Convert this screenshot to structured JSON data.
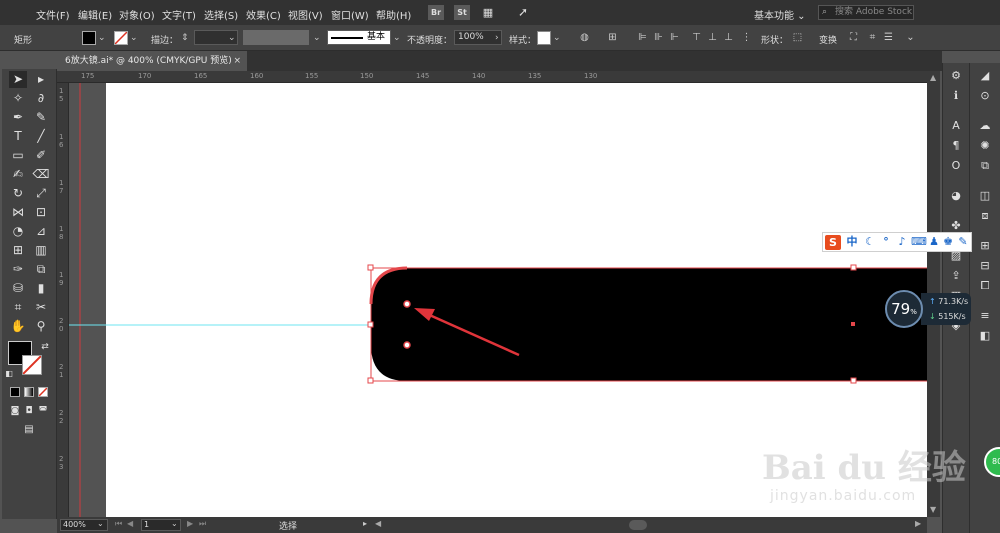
{
  "menubar": {
    "items": [
      "文件(F)",
      "编辑(E)",
      "对象(O)",
      "文字(T)",
      "选择(S)",
      "效果(C)",
      "视图(V)",
      "窗口(W)",
      "帮助(H)"
    ],
    "bridge_label": "Br",
    "stock_label": "St",
    "workspace": "基本功能",
    "search_placeholder": "搜索 Adobe Stock"
  },
  "controlbar": {
    "object_type": "矩形",
    "stroke_label": "描边：",
    "stroke_profile": "基本",
    "opacity_label": "不透明度：",
    "opacity_value": "100%",
    "style_label": "样式：",
    "shape_label": "形状：",
    "transform_label": "变换"
  },
  "document_tab": {
    "title": "6放大镜.ai* @ 400% (CMYK/GPU 预览)",
    "close": "×"
  },
  "ruler": {
    "top_ticks": [
      "175",
      "170",
      "165",
      "160",
      "155",
      "150",
      "145",
      "140",
      "135",
      "130"
    ],
    "left_ticks": [
      "1",
      "5",
      "1",
      "6",
      "1",
      "7",
      "1",
      "8",
      "1",
      "9",
      "2",
      "0",
      "2",
      "1",
      "2",
      "2",
      "2",
      "3"
    ]
  },
  "statusbar": {
    "zoom": "400%",
    "page": "1",
    "status": "选择"
  },
  "ime": {
    "logo": "S",
    "mode": "中"
  },
  "net_widget": {
    "percent": "79",
    "percent_unit": "%",
    "upload": "71.3",
    "upload_unit": "K/s",
    "download": "515",
    "download_unit": "K/s"
  },
  "watermark": {
    "brand": "Bai du 经验",
    "url": "jingyan.baidu.com"
  },
  "badge": "80",
  "colors": {
    "fill": "#000000",
    "selection": "#e4474b",
    "guide": "#6ee6f0",
    "arrow": "#e0343a"
  }
}
